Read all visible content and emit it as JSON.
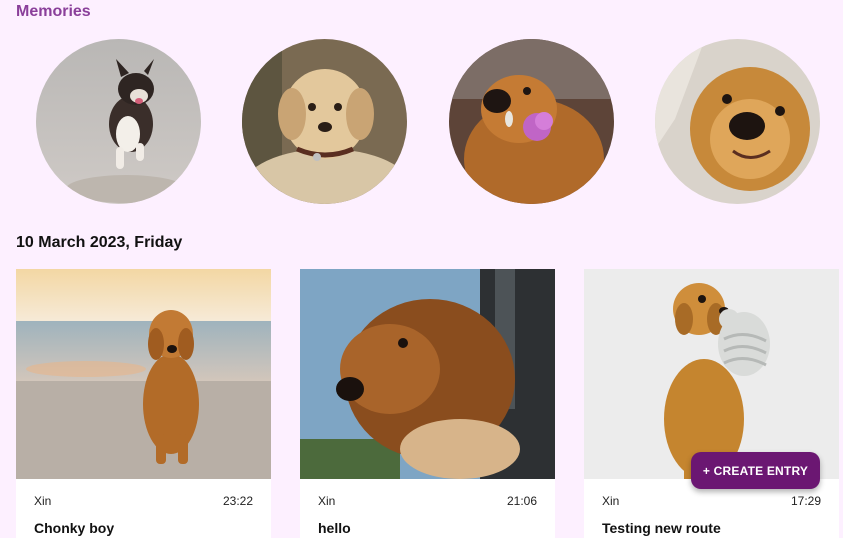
{
  "memories": {
    "title": "Memories",
    "items": [
      {
        "subject": "tricolor-puppy-running-beach-photo"
      },
      {
        "subject": "golden-retriever-puppy-photo"
      },
      {
        "subject": "golden-retriever-with-flower-photo"
      },
      {
        "subject": "golden-retriever-closeup-photo"
      }
    ]
  },
  "day": {
    "date_label": "10 March 2023, Friday"
  },
  "entries": [
    {
      "author": "Xin",
      "time": "23:22",
      "title": "Chonky boy"
    },
    {
      "author": "Xin",
      "time": "21:06",
      "title": "hello"
    },
    {
      "author": "Xin",
      "time": "17:29",
      "title": "Testing new route"
    }
  ],
  "actions": {
    "create_entry_label": "+ CREATE ENTRY"
  },
  "colors": {
    "background": "#fdf0ff",
    "section_title": "#8a3f9a",
    "fab": "#6b1772"
  }
}
